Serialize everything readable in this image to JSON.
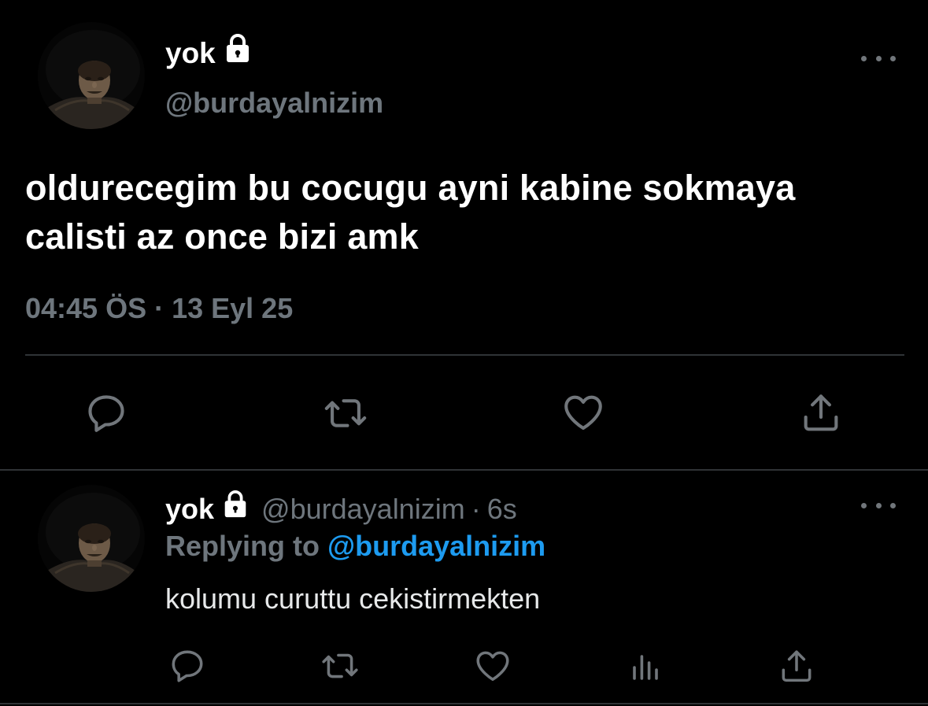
{
  "main_tweet": {
    "display_name": "yok",
    "handle": "@burdayalnizim",
    "text": "oldurecegim bu cocugu ayni kabine sokmaya calisti az once bizi amk",
    "time": "04:45 ÖS",
    "separator": "·",
    "date": "13 Eyl 25",
    "actions": [
      "reply-icon",
      "retweet-icon",
      "like-icon",
      "share-icon"
    ]
  },
  "reply_tweet": {
    "display_name": "yok",
    "handle": "@burdayalnizim",
    "separator": "·",
    "time": "6s",
    "replying_label": "Replying to",
    "replying_to": "@burdayalnizim",
    "text": "kolumu curuttu cekistirmekten",
    "actions": [
      "reply-icon",
      "retweet-icon",
      "like-icon",
      "analytics-icon",
      "share-icon"
    ]
  },
  "colors": {
    "background": "#000000",
    "text": "#ffffff",
    "secondary": "#6e767d",
    "accent": "#1d9bf0",
    "divider": "#2f3336"
  }
}
